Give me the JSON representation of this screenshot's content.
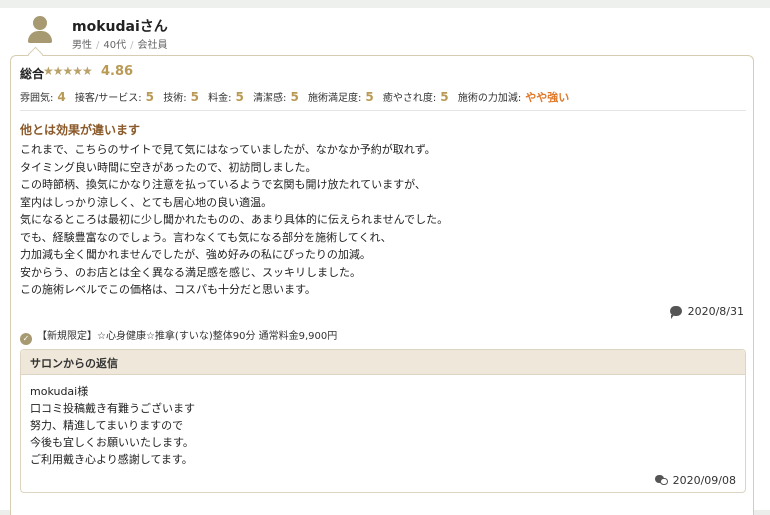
{
  "reviewer": {
    "name": "mokudaiさん",
    "gender": "男性",
    "age": "40代",
    "job": "会社員"
  },
  "rating": {
    "overall_label": "総合",
    "stars": "★★★★★",
    "overall_score": "4.86",
    "overall_value": 4.86,
    "categories": [
      {
        "label": "雰囲気:",
        "value": "4"
      },
      {
        "label": "接客/サービス:",
        "value": "5"
      },
      {
        "label": "技術:",
        "value": "5"
      },
      {
        "label": "料金:",
        "value": "5"
      },
      {
        "label": "清潔感:",
        "value": "5"
      },
      {
        "label": "施術満足度:",
        "value": "5"
      },
      {
        "label": "癒やされ度:",
        "value": "5"
      }
    ],
    "strength_label": "施術の力加減:",
    "strength_value": "やや強い"
  },
  "review": {
    "title": "他とは効果が違います",
    "lines": [
      "これまで、こちらのサイトで見て気にはなっていましたが、なかなか予約が取れず。",
      "タイミング良い時間に空きがあったので、初訪問しました。",
      "この時節柄、換気にかなり注意を払っているようで玄関も開け放たれていますが、",
      "室内はしっかり涼しく、とても居心地の良い適温。",
      "気になるところは最初に少し聞かれたものの、あまり具体的に伝えられませんでした。",
      "でも、経験豊富なのでしょう。言わなくても気になる部分を施術してくれ、",
      "力加減も全く聞かれませんでしたが、強め好みの私にぴったりの加減。",
      "安からう、のお店とは全く異なる満足感を感じ、スッキリしました。",
      "この施術レベルでこの価格は、コスパも十分だと思います。"
    ],
    "date": "2020/8/31",
    "menu": "【新規限定】☆心身健康☆推拿(すいな)整体90分 通常料金9,900円"
  },
  "reply": {
    "title": "サロンからの返信",
    "lines": [
      "mokudai様",
      "口コミ投稿戴き有難うございます",
      "努力、精進してまいりますので",
      "今後も宜しくお願いいたします。",
      "ご利用戴き心より感謝してます。"
    ],
    "date": "2020/09/08"
  },
  "colors": {
    "accent_gold": "#b99a55",
    "title_brown": "#8b5a2b",
    "strength_orange": "#e07a2b",
    "reply_header_bg": "#efe8da"
  }
}
